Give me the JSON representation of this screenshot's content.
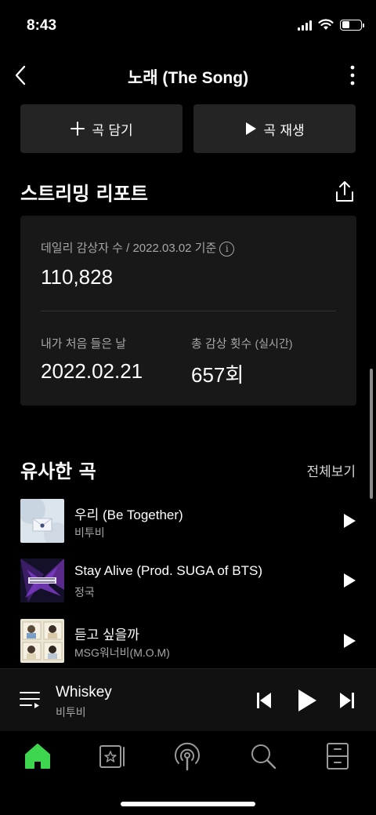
{
  "status": {
    "time": "8:43"
  },
  "nav": {
    "title": "노래 (The Song)",
    "back_icon": "chevron-left-icon",
    "more_icon": "more-vertical-icon"
  },
  "actions": {
    "add_label": "곡 담기",
    "play_label": "곡 재생"
  },
  "report": {
    "title": "스트리밍 리포트",
    "daily_label": "데일리 감상자 수 / 2022.03.02 기준",
    "daily_value": "110,828",
    "first_label": "내가 처음 들은 날",
    "first_value": "2022.02.21",
    "total_label": "총 감상 횟수",
    "total_suffix": "(실시간)",
    "total_value": "657회"
  },
  "similar": {
    "title": "유사한 곡",
    "view_all": "전체보기",
    "tracks": [
      {
        "name": "우리 (Be Together)",
        "artist": "비투비"
      },
      {
        "name": "Stay Alive (Prod. SUGA of BTS)",
        "artist": "정국"
      },
      {
        "name": "듣고 싶을까",
        "artist": "MSG워너비(M.O.M)"
      }
    ]
  },
  "player": {
    "title": "Whiskey",
    "artist": "비투비"
  },
  "colors": {
    "accent": "#3fd64f",
    "background": "#000000",
    "card": "#181818",
    "button": "#242424"
  },
  "tabs": [
    "home-icon",
    "library-icon",
    "podcast-icon",
    "search-icon",
    "storage-icon"
  ]
}
